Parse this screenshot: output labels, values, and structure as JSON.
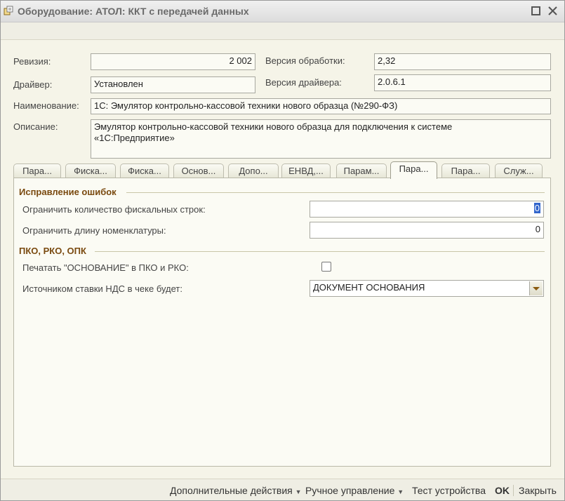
{
  "window": {
    "title": "Оборудование: АТОЛ: ККТ с передачей данных"
  },
  "info": {
    "revision_label": "Ревизия:",
    "revision_value": "2 002",
    "version_processing_label": "Версия обработки:",
    "version_processing_value": "2,32",
    "driver_label": "Драйвер:",
    "driver_value": "Установлен",
    "version_driver_label": "Версия драйвера:",
    "version_driver_value": "2.0.6.1",
    "name_label": "Наименование:",
    "name_value": "1С: Эмулятор контрольно-кассовой техники нового образца (№290-ФЗ)",
    "desc_label": "Описание:",
    "desc_line1": "Эмулятор контрольно-кассовой техники нового образца для подключения к системе",
    "desc_line2": "«1С:Предприятие»"
  },
  "tabs": [
    {
      "label": "Пара..."
    },
    {
      "label": "Фиска..."
    },
    {
      "label": "Фиска..."
    },
    {
      "label": "Основ..."
    },
    {
      "label": "Допо..."
    },
    {
      "label": "ЕНВД,..."
    },
    {
      "label": "Парам..."
    },
    {
      "label": "Пара..."
    },
    {
      "label": "Пара..."
    },
    {
      "label": "Служ..."
    }
  ],
  "active_tab_index": 7,
  "panel": {
    "group1_title": "Исправление ошибок",
    "limit_fiscal_label": "Ограничить количество фискальных строк:",
    "limit_fiscal_value": "0",
    "limit_nomenclature_label": "Ограничить длину номенклатуры:",
    "limit_nomenclature_value": "0",
    "group2_title": "ПКО, РКО, ОПК",
    "print_basis_label": "Печатать \"ОСНОВАНИЕ\" в ПКО и РКО:",
    "print_basis_checked": false,
    "vat_source_label": "Источником ставки НДС в чеке будет:",
    "vat_source_value": "ДОКУМЕНТ ОСНОВАНИЯ"
  },
  "footer": {
    "extra_actions": "Дополнительные действия",
    "manual_control": "Ручное управление",
    "test_device": "Тест устройства",
    "ok": "OK",
    "close": "Закрыть"
  },
  "colors": {
    "accent": "#7a4a10",
    "background": "#f5f4e8",
    "selection": "#3366cc"
  }
}
